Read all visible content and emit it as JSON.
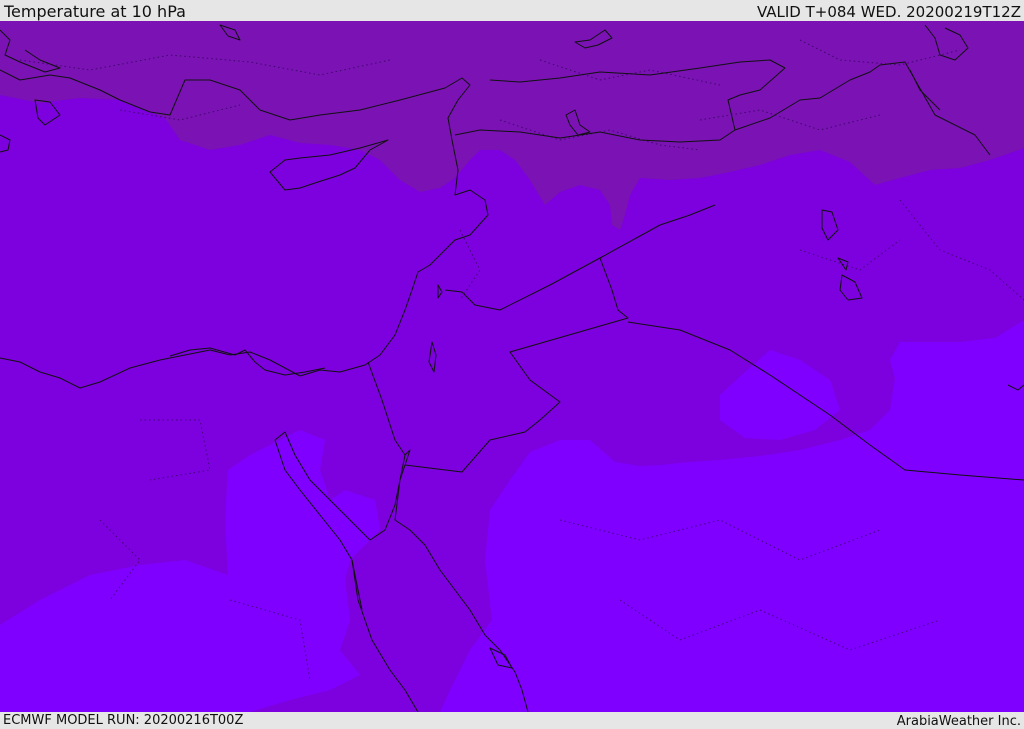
{
  "header": {
    "title": "Temperature at 10 hPa",
    "valid": "VALID T+084 WED. 20200219T12Z"
  },
  "footer": {
    "model_run": "ECMWF MODEL RUN: 20200216T00Z",
    "credit": "ArabiaWeather Inc."
  },
  "colors": {
    "cold_band": "#7a12b4",
    "mid_band": "#7d00de",
    "warm_band": "#7f00ff",
    "outline": "#111111",
    "background_bar": "#e6e6e6"
  }
}
